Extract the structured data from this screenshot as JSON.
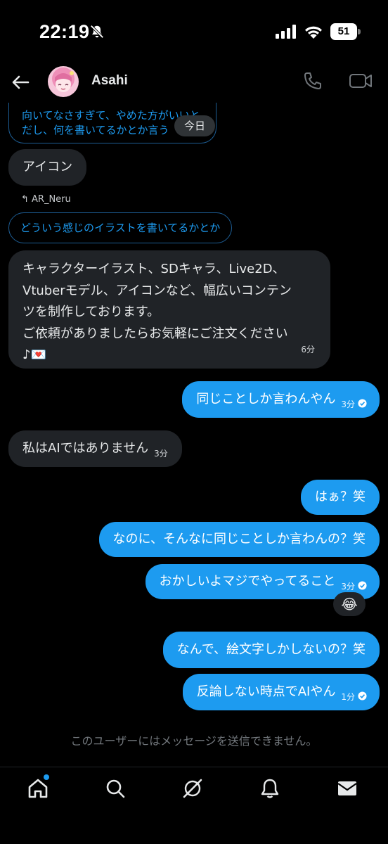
{
  "status_bar": {
    "time": "22:19",
    "battery": "51"
  },
  "header": {
    "contact_name": "Asahi"
  },
  "chat": {
    "quoted_top": {
      "line1": "向いてなさすぎて、やめた方がいいと",
      "line2": "だし、何を書いてるかとか言う"
    },
    "date_separator": "今日",
    "messages": [
      {
        "direction": "in",
        "text": "アイコン",
        "time": ""
      },
      {
        "direction": "in",
        "reply_to_user": "AR_Neru",
        "quoted_text": "どういう感じのイラストを書いてるかとか"
      },
      {
        "direction": "in",
        "lines": [
          "キャラクターイラスト、SDキャラ、Live2D、",
          "Vtuberモデル、アイコンなど、幅広いコンテン",
          "ツを制作しております。",
          "ご依頼がありましたらお気軽にご注文ください",
          "♪💌"
        ],
        "time": "6分"
      },
      {
        "direction": "out",
        "text": "同じことしか言わんやん",
        "time": "3分"
      },
      {
        "direction": "in",
        "text": "私はAIではありません",
        "time": "3分"
      },
      {
        "direction": "out",
        "text": "はぁ？笑",
        "time": ""
      },
      {
        "direction": "out",
        "text": "なのに、そんなに同じことしか言わんの？笑",
        "time": ""
      },
      {
        "direction": "out",
        "text": "おかしいよマジでやってること",
        "time": "3分",
        "reaction": "😂"
      },
      {
        "direction": "out",
        "text": "なんで、絵文字しかしないの？笑",
        "time": ""
      },
      {
        "direction": "out",
        "text": "反論しない時点でAIやん",
        "time": "1分"
      }
    ],
    "notice": "このユーザーにはメッセージを送信できません。"
  },
  "bottom_nav": {
    "items": [
      {
        "icon": "home-icon",
        "active": true,
        "has_dot": true
      },
      {
        "icon": "search-icon"
      },
      {
        "icon": "grok-icon"
      },
      {
        "icon": "bell-icon"
      },
      {
        "icon": "mail-icon"
      }
    ]
  },
  "colors": {
    "accent": "#1d9bf0",
    "incoming_bubble": "#202327",
    "background": "#000000",
    "muted": "#71767b"
  }
}
